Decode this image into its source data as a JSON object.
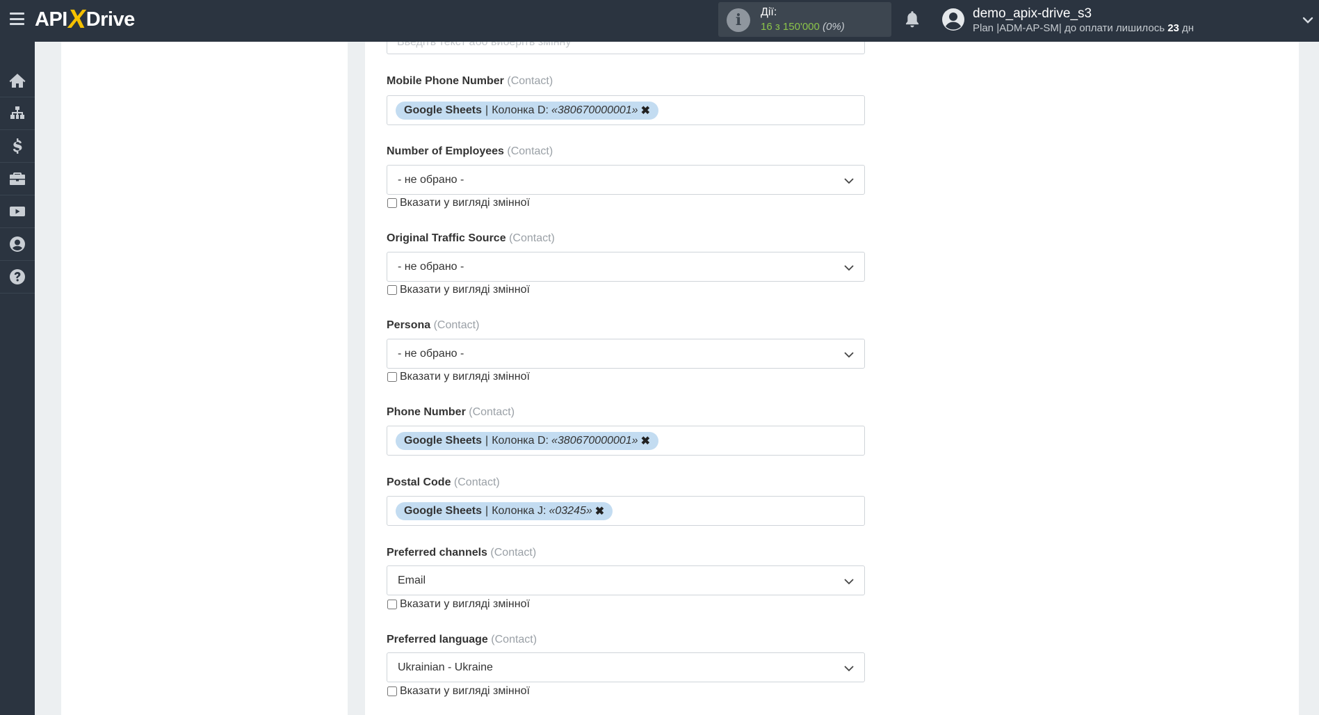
{
  "topbar": {
    "logo_left": "API",
    "logo_x": "X",
    "logo_right": "Drive",
    "actions_label": "Дії:",
    "actions_used": "16",
    "actions_of": "з",
    "actions_total": "150'000",
    "actions_percent": "(0%)",
    "username": "demo_apix-drive_s3",
    "plan_prefix": "Plan |ADM-AP-SM| до оплати лишилось",
    "plan_days": "23",
    "plan_days_unit": "дн"
  },
  "sidebar": {
    "items": [
      {
        "icon": "home-icon"
      },
      {
        "icon": "sitemap-icon"
      },
      {
        "icon": "dollar-icon"
      },
      {
        "icon": "briefcase-icon"
      },
      {
        "icon": "youtube-icon"
      },
      {
        "icon": "user-circle-icon"
      },
      {
        "icon": "question-circle-icon"
      }
    ]
  },
  "form": {
    "top_cut_text": "Введіть текст або виберіть змінну",
    "var_checkbox_label": "Вказати у вигляді змінної",
    "context_label": "(Contact)",
    "fields": [
      {
        "label": "Mobile Phone Number",
        "type": "tag",
        "source": "Google Sheets",
        "column": "Колонка D:",
        "value": "«380670000001»"
      },
      {
        "label": "Number of Employees",
        "type": "select",
        "value": "- не обрано -"
      },
      {
        "label": "Original Traffic Source",
        "type": "select",
        "value": "- не обрано -"
      },
      {
        "label": "Persona",
        "type": "select",
        "value": "- не обрано -"
      },
      {
        "label": "Phone Number",
        "type": "tag",
        "source": "Google Sheets",
        "column": "Колонка D:",
        "value": "«380670000001»"
      },
      {
        "label": "Postal Code",
        "type": "tag",
        "source": "Google Sheets",
        "column": "Колонка J:",
        "value": "«03245»"
      },
      {
        "label": "Preferred channels",
        "type": "select",
        "value": "Email"
      },
      {
        "label": "Preferred language",
        "type": "select",
        "value": "Ukrainian - Ukraine"
      }
    ]
  },
  "colors": {
    "topbar_bg": "#2b3440",
    "accent_yellow": "#f5c000",
    "actions_green": "#8bc34a",
    "tag_bg": "#c3dcf1"
  }
}
